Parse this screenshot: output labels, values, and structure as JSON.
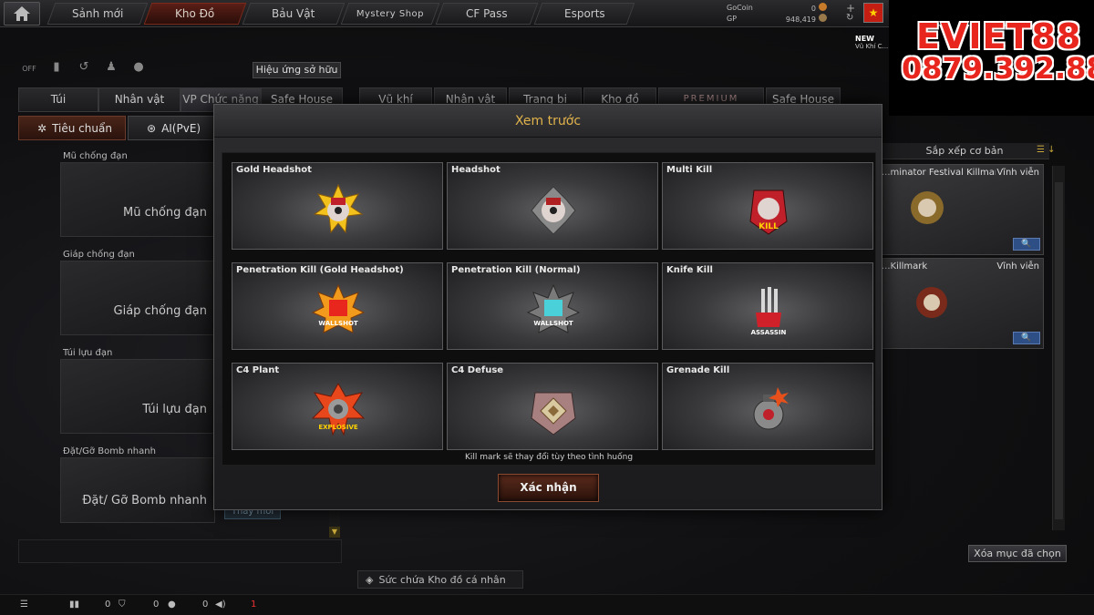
{
  "nav": {
    "tabs": [
      "Sảnh mới",
      "Kho Đồ",
      "Bảu Vật",
      "Mystery Shop",
      "CF Pass",
      "Esports"
    ],
    "active_tab": "Kho Đồ",
    "gocoin_label": "GoCoin",
    "gocoin_value": "0",
    "gp_label": "GP",
    "gp_value": "948,419"
  },
  "watermark": {
    "line1": "EVIET88",
    "line2": "0879.392.888"
  },
  "new_badge": {
    "label": "NEW",
    "sub": "Vũ Khí C..."
  },
  "left": {
    "icon_toggle_label": "OFF",
    "effect_button": "Hiệu ứng sở hữu",
    "tabs": [
      "Túi",
      "Nhân vật",
      "VP Chức năng",
      "Safe House"
    ],
    "modes": [
      "Tiêu chuẩn",
      "AI(PvE)"
    ],
    "slots": [
      {
        "label": "Mũ chống đạn",
        "placeholder": "Mũ chống đạn"
      },
      {
        "label": "Giáp chống đạn",
        "placeholder": "Giáp chống đạn"
      },
      {
        "label": "Túi lựu đạn",
        "placeholder": "Túi lựu đạn"
      },
      {
        "label": "Đặt/Gỡ Bomb nhanh",
        "placeholder": "Đặt/ Gỡ Bomb nhanh"
      }
    ],
    "replace_button": "Thay mới"
  },
  "right": {
    "tabs": [
      "Vũ khí",
      "Nhân vật",
      "Trang bị",
      "Kho đồ",
      "PREMIUM",
      "Safe House"
    ],
    "sort_label": "Sắp xếp cơ bản",
    "items": [
      {
        "name": "...minator Festival Killmark",
        "duration": "Vĩnh viễn"
      },
      {
        "name": "...Killmark",
        "duration": "Vĩnh viễn"
      }
    ],
    "clear_button": "Xóa mục đã chọn",
    "inventory_capacity": "Sức chứa Kho đồ cá nhân"
  },
  "modal": {
    "title": "Xem trước",
    "cards": [
      {
        "label": "Gold Headshot",
        "icon": "gold-headshot-icon",
        "color": "#f2c11b"
      },
      {
        "label": "Headshot",
        "icon": "headshot-icon",
        "color": "#b8b8b8"
      },
      {
        "label": "Multi Kill",
        "icon": "multi-kill-icon",
        "color": "#c0202a"
      },
      {
        "label": "Penetration Kill (Gold Headshot)",
        "icon": "wallshot-gold-icon",
        "color": "#f29a1b"
      },
      {
        "label": "Penetration Kill (Normal)",
        "icon": "wallshot-normal-icon",
        "color": "#4ad0d8"
      },
      {
        "label": "Knife Kill",
        "icon": "knife-kill-icon",
        "color": "#d0202a"
      },
      {
        "label": "C4 Plant",
        "icon": "c4-plant-icon",
        "color": "#e8461b"
      },
      {
        "label": "C4 Defuse",
        "icon": "c4-defuse-icon",
        "color": "#c8a0a0"
      },
      {
        "label": "Grenade Kill",
        "icon": "grenade-kill-icon",
        "color": "#e8501b"
      }
    ],
    "note": "Kill mark sẽ thay đổi tùy theo tình huống",
    "confirm_button": "Xác nhận"
  },
  "status": {
    "count1": "0",
    "count2": "0",
    "count3": "0",
    "notifications": "1"
  }
}
